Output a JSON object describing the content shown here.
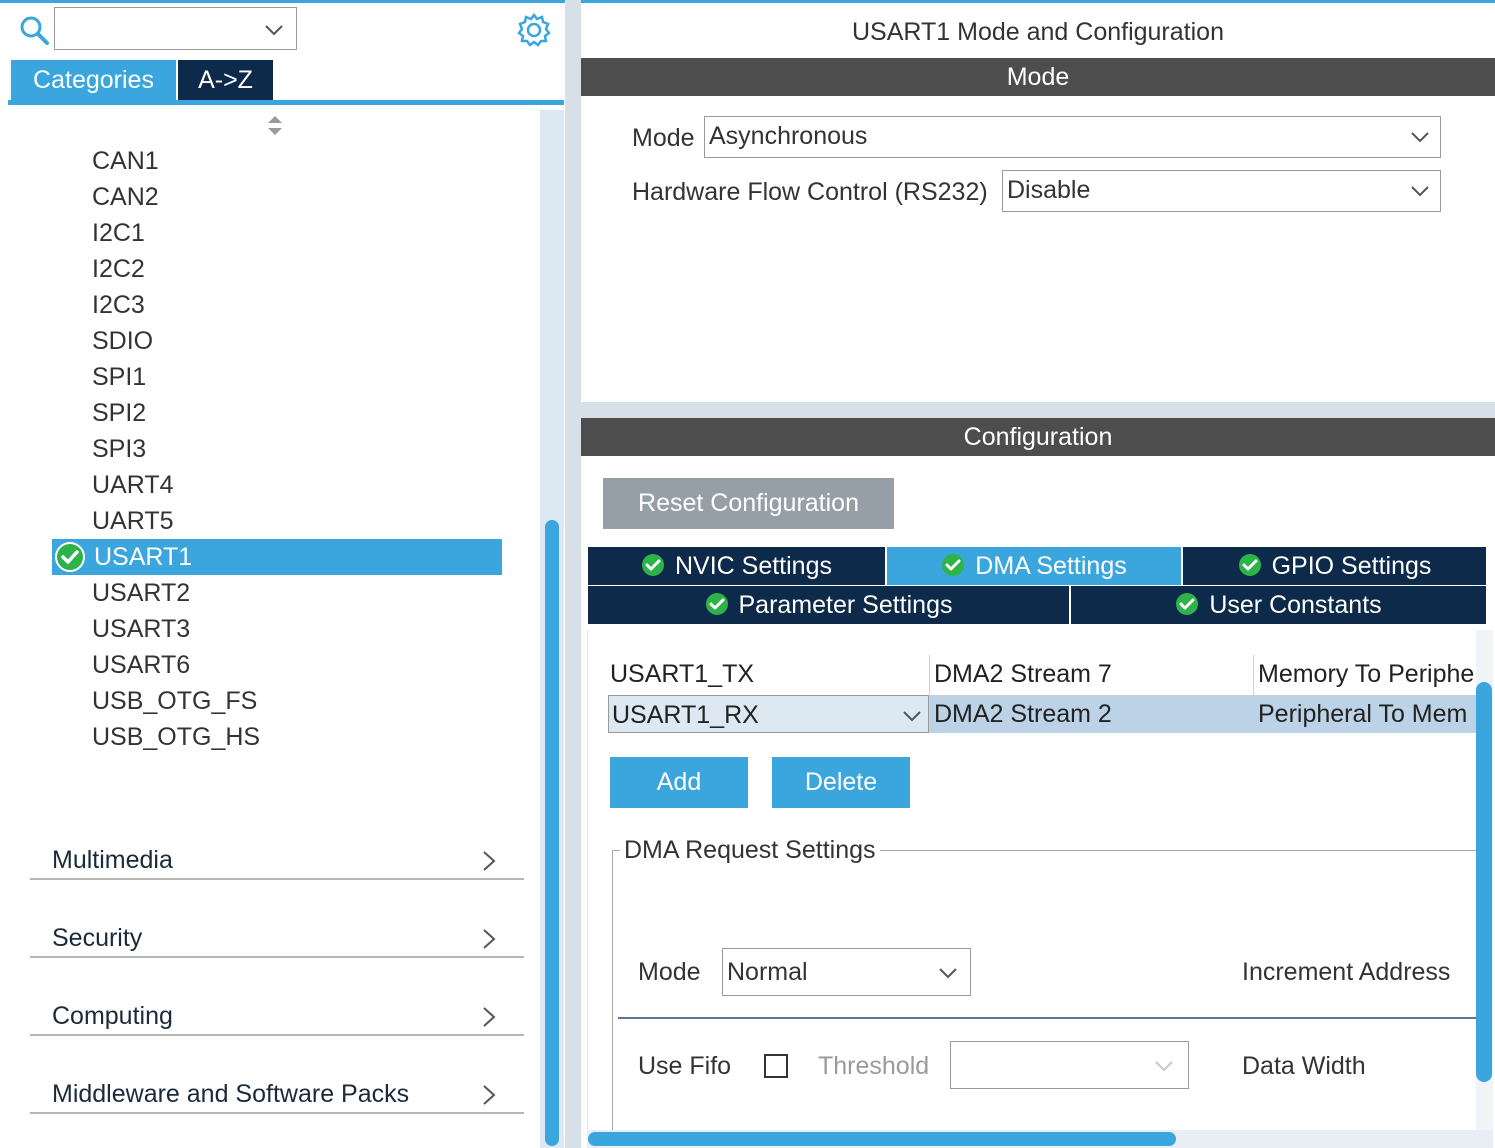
{
  "left": {
    "search_value": "",
    "tabs": [
      {
        "label": "Categories",
        "active": true
      },
      {
        "label": "A->Z",
        "active": false
      }
    ],
    "peripherals": [
      "CAN1",
      "CAN2",
      "I2C1",
      "I2C2",
      "I2C3",
      "SDIO",
      "SPI1",
      "SPI2",
      "SPI3",
      "UART4",
      "UART5",
      "USART1",
      "USART2",
      "USART3",
      "USART6",
      "USB_OTG_FS",
      "USB_OTG_HS"
    ],
    "selected_peripheral": "USART1",
    "categories": [
      "Multimedia",
      "Security",
      "Computing",
      "Middleware and Software Packs"
    ]
  },
  "right": {
    "title": "USART1 Mode and Configuration",
    "mode_header": "Mode",
    "mode_label": "Mode",
    "mode_value": "Asynchronous",
    "hwfc_label": "Hardware Flow Control (RS232)",
    "hwfc_value": "Disable",
    "config_header": "Configuration",
    "reset_label": "Reset Configuration",
    "tabs_row1": [
      "NVIC Settings",
      "DMA Settings",
      "GPIO Settings"
    ],
    "tabs_row2": [
      "Parameter Settings",
      "User Constants"
    ],
    "active_tab": "DMA Settings",
    "dma_rows": [
      {
        "request": "USART1_TX",
        "stream": "DMA2 Stream 7",
        "direction": "Memory To Periphe"
      },
      {
        "request": "USART1_RX",
        "stream": "DMA2 Stream 2",
        "direction": "Peripheral To Mem"
      }
    ],
    "add_label": "Add",
    "delete_label": "Delete",
    "request_settings_title": "DMA Request Settings",
    "dma_mode_label": "Mode",
    "dma_mode_value": "Normal",
    "increment_label": "Increment Address",
    "use_fifo_label": "Use Fifo",
    "use_fifo_checked": false,
    "threshold_label": "Threshold",
    "threshold_value": "",
    "data_width_label": "Data Width"
  },
  "colors": {
    "accent": "#3aa6dd",
    "dark_navy": "#0d2a4a",
    "header_gray": "#4d4d4d",
    "check_green": "#2eb34a"
  }
}
